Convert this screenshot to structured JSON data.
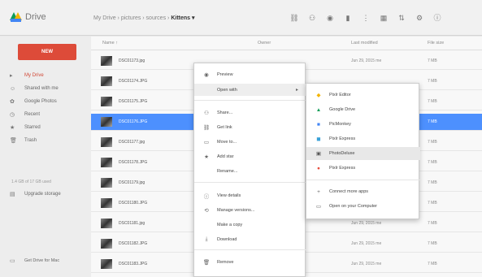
{
  "app": {
    "title": "Drive"
  },
  "breadcrumb": {
    "path": "My Drive › pictures › sources ›",
    "current": "Kittens ▾"
  },
  "toolbar": {
    "icons": [
      "link-icon",
      "add-person-icon",
      "preview-icon",
      "trash-icon",
      "more-icon",
      "grid-view-icon",
      "sort-icon",
      "settings-icon",
      "info-icon"
    ]
  },
  "sidebar": {
    "new_label": "NEW",
    "items": [
      {
        "label": "My Drive",
        "icon": "▸"
      },
      {
        "label": "Shared with me",
        "icon": "☺"
      },
      {
        "label": "Google Photos",
        "icon": "✿"
      },
      {
        "label": "Recent",
        "icon": "◷"
      },
      {
        "label": "Starred",
        "icon": "★"
      },
      {
        "label": "Trash",
        "icon": "🗑"
      }
    ],
    "storage": "1.4 GB of 17 GB used",
    "upgrade_label": "Upgrade storage",
    "get_drive_label": "Get Drive for Mac"
  },
  "columns": {
    "name": "Name ↑",
    "owner": "Owner",
    "modified": "Last modified",
    "size": "File size"
  },
  "rows": [
    {
      "name": "DSC01173.jpg",
      "modified": "Jun 29, 2015 me",
      "size": "7 MB"
    },
    {
      "name": "DSC01174.JPG",
      "modified": "",
      "size": "7 MB"
    },
    {
      "name": "DSC01175.JPG",
      "modified": "",
      "size": "7 MB"
    },
    {
      "name": "DSC01176.JPG",
      "modified": "",
      "size": "7 MB"
    },
    {
      "name": "DSC01177.jpg",
      "modified": "",
      "size": "7 MB"
    },
    {
      "name": "DSC01178.JPG",
      "modified": "",
      "size": "7 MB"
    },
    {
      "name": "DSC01179.jpg",
      "modified": "",
      "size": "7 MB"
    },
    {
      "name": "DSC01180.JPG",
      "modified": "",
      "size": "7 MB"
    },
    {
      "name": "DSC01181.jpg",
      "modified": "Jun 29, 2015 me",
      "size": "7 MB"
    },
    {
      "name": "DSC01182.JPG",
      "modified": "Jun 29, 2015 me",
      "size": "7 MB"
    },
    {
      "name": "DSC01183.JPG",
      "modified": "Jun 29, 2015 me",
      "size": "7 MB"
    }
  ],
  "context_menu": {
    "items": [
      {
        "label": "Preview",
        "icon": "◉"
      },
      {
        "label": "Open with",
        "icon": "",
        "submenu": true
      },
      {
        "label": "Share...",
        "icon": "⚇"
      },
      {
        "label": "Get link",
        "icon": "⛓"
      },
      {
        "label": "Move to...",
        "icon": "▭"
      },
      {
        "label": "Add star",
        "icon": "★"
      },
      {
        "label": "Rename...",
        "icon": ""
      },
      {
        "label": "View details",
        "icon": "ⓘ"
      },
      {
        "label": "Manage versions...",
        "icon": "⟲"
      },
      {
        "label": "Make a copy",
        "icon": ""
      },
      {
        "label": "Download",
        "icon": "⤓"
      },
      {
        "label": "Remove",
        "icon": "🗑"
      }
    ]
  },
  "submenu": {
    "items": [
      {
        "label": "Pixlr Editor",
        "icon": "◆",
        "color": "#f4b400"
      },
      {
        "label": "Google Drive",
        "icon": "▲",
        "color": "#0f9d58"
      },
      {
        "label": "PicMonkey",
        "icon": "■",
        "color": "#4285f4"
      },
      {
        "label": "Pixlr Express",
        "icon": "◼",
        "color": "#3aa1d8"
      },
      {
        "label": "PhotoDeluxe",
        "icon": "▣",
        "color": "#555555"
      },
      {
        "label": "Pixlr Express",
        "icon": "●",
        "color": "#e74c3c"
      },
      {
        "label": "Connect more apps",
        "icon": "+",
        "color": "#666666"
      },
      {
        "label": "Open on your Computer",
        "icon": "▭",
        "color": "#666666"
      }
    ]
  }
}
